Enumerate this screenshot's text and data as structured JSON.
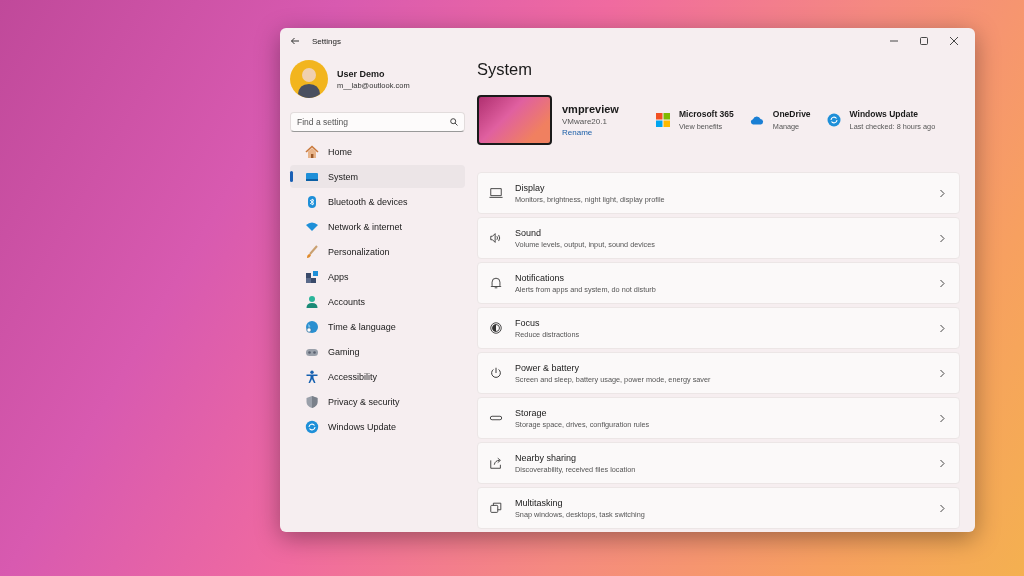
{
  "window": {
    "title": "Settings"
  },
  "user": {
    "name": "User Demo",
    "email": "m__lab@outlook.com"
  },
  "search": {
    "placeholder": "Find a setting"
  },
  "nav": [
    {
      "label": "Home",
      "selected": false
    },
    {
      "label": "System",
      "selected": true
    },
    {
      "label": "Bluetooth & devices",
      "selected": false
    },
    {
      "label": "Network & internet",
      "selected": false
    },
    {
      "label": "Personalization",
      "selected": false
    },
    {
      "label": "Apps",
      "selected": false
    },
    {
      "label": "Accounts",
      "selected": false
    },
    {
      "label": "Time & language",
      "selected": false
    },
    {
      "label": "Gaming",
      "selected": false
    },
    {
      "label": "Accessibility",
      "selected": false
    },
    {
      "label": "Privacy & security",
      "selected": false
    },
    {
      "label": "Windows Update",
      "selected": false
    }
  ],
  "page_title": "System",
  "device": {
    "name": "vmpreview",
    "model": "VMware20.1",
    "rename": "Rename"
  },
  "quick_links": [
    {
      "title": "Microsoft 365",
      "subtitle": "View benefits"
    },
    {
      "title": "OneDrive",
      "subtitle": "Manage"
    },
    {
      "title": "Windows Update",
      "subtitle": "Last checked: 8 hours ago"
    }
  ],
  "settings": [
    {
      "title": "Display",
      "subtitle": "Monitors, brightness, night light, display profile"
    },
    {
      "title": "Sound",
      "subtitle": "Volume levels, output, input, sound devices"
    },
    {
      "title": "Notifications",
      "subtitle": "Alerts from apps and system, do not disturb"
    },
    {
      "title": "Focus",
      "subtitle": "Reduce distractions"
    },
    {
      "title": "Power & battery",
      "subtitle": "Screen and sleep, battery usage, power mode, energy saver"
    },
    {
      "title": "Storage",
      "subtitle": "Storage space, drives, configuration rules"
    },
    {
      "title": "Nearby sharing",
      "subtitle": "Discoverability, received files location"
    },
    {
      "title": "Multitasking",
      "subtitle": "Snap windows, desktops, task switching"
    }
  ]
}
